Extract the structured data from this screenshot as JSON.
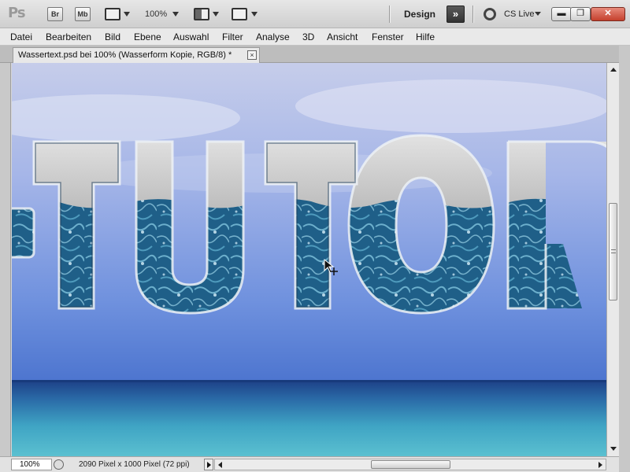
{
  "app": {
    "logo": "Ps",
    "bridge_badge": "Br",
    "minibridge_badge": "Mb",
    "zoom_level": "100%",
    "workspace": "Design",
    "cs_live": "CS Live"
  },
  "menu": [
    "Datei",
    "Bearbeiten",
    "Bild",
    "Ebene",
    "Auswahl",
    "Filter",
    "Analyse",
    "3D",
    "Ansicht",
    "Fenster",
    "Hilfe"
  ],
  "document": {
    "tab_title": "Wassertext.psd bei 100% (Wasserform Kopie, RGB/8) *",
    "close_glyph": "×",
    "artwork_text": "-TUTOR"
  },
  "status": {
    "zoom": "100%",
    "doc_info": "2090 Pixel x 1000 Pixel (72 ppi)"
  },
  "colors": {
    "sky_top": "#c3cbea",
    "sky_mid": "#5b7fd3",
    "sea_deep": "#1f4f96",
    "sea_shallow": "#4db0c8",
    "letter_top": "#cfcfcf",
    "letter_water": "#1e5f86",
    "close_button": "#c4402d"
  },
  "icons": [
    "launch-bridge-icon",
    "mini-bridge-icon",
    "view-extras-icon",
    "arrange-documents-icon",
    "screen-mode-icon",
    "workspace-switcher-icon",
    "cs-live-icon",
    "minimize-icon",
    "restore-icon",
    "close-icon"
  ]
}
